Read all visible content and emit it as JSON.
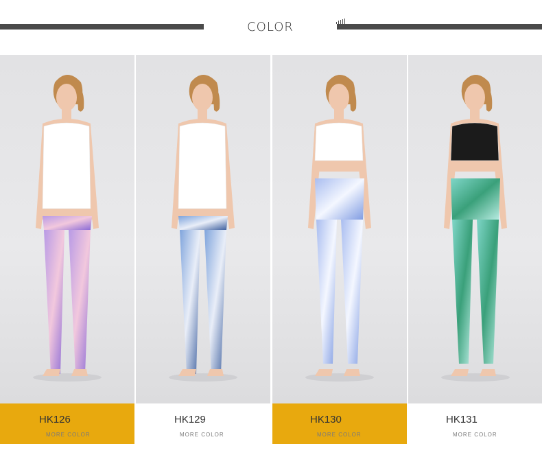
{
  "header": {
    "title": "COLOR"
  },
  "products": [
    {
      "code": "HK126",
      "more": "MORE COLOR",
      "caption_bg": "#e8a90e",
      "top_color": "#ffffff",
      "legging_colors": [
        "#b89ae6",
        "#f2c8dd",
        "#8a6ad6"
      ]
    },
    {
      "code": "HK129",
      "more": "MORE COLOR",
      "caption_bg": "#ffffff",
      "top_color": "#ffffff",
      "legging_colors": [
        "#7fa4dc",
        "#e9eef8",
        "#3d5f9e"
      ]
    },
    {
      "code": "HK130",
      "more": "MORE COLOR",
      "caption_bg": "#e8a90e",
      "top_color": "#ffffff",
      "legging_colors": [
        "#a9bdf0",
        "#f4f7ff",
        "#7f9be2"
      ]
    },
    {
      "code": "HK131",
      "more": "MORE COLOR",
      "caption_bg": "#ffffff",
      "top_color": "#1b1b1b",
      "legging_colors": [
        "#7fd6c8",
        "#3aa07a",
        "#b9ece3"
      ]
    }
  ],
  "colors": {
    "accent": "#e8a90e",
    "rule": "#4a4a4a",
    "skin": "#efc7ad",
    "hair": "#c08a4e"
  }
}
